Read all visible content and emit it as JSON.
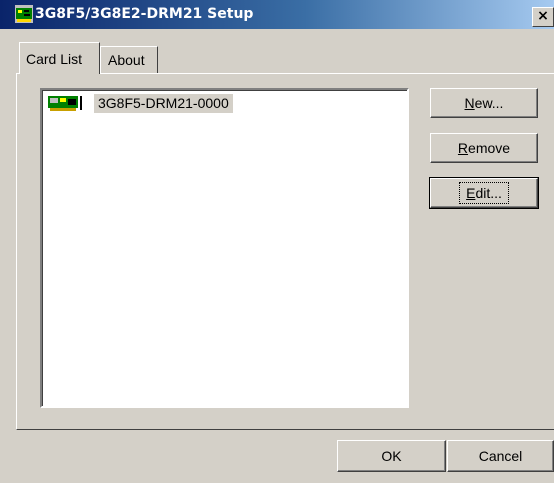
{
  "window": {
    "title": "3G8F5/3G8E2-DRM21 Setup",
    "close_symbol": "×"
  },
  "tabs": [
    {
      "label": "Card List",
      "active": true
    },
    {
      "label": "About",
      "active": false
    }
  ],
  "card_list": {
    "items": [
      {
        "label": "3G8F5-DRM21-0000",
        "icon": "network-card-icon",
        "selected": true
      }
    ]
  },
  "buttons": {
    "new": {
      "mnemonic": "N",
      "rest": "ew..."
    },
    "remove": {
      "mnemonic": "R",
      "rest": "emove"
    },
    "edit": {
      "mnemonic": "E",
      "rest": "dit..."
    },
    "ok": "OK",
    "cancel": "Cancel"
  },
  "colors": {
    "face": "#d4d0c8",
    "title_start": "#0a246a",
    "title_end": "#a6caf0",
    "selection": "#d4d0c8"
  }
}
